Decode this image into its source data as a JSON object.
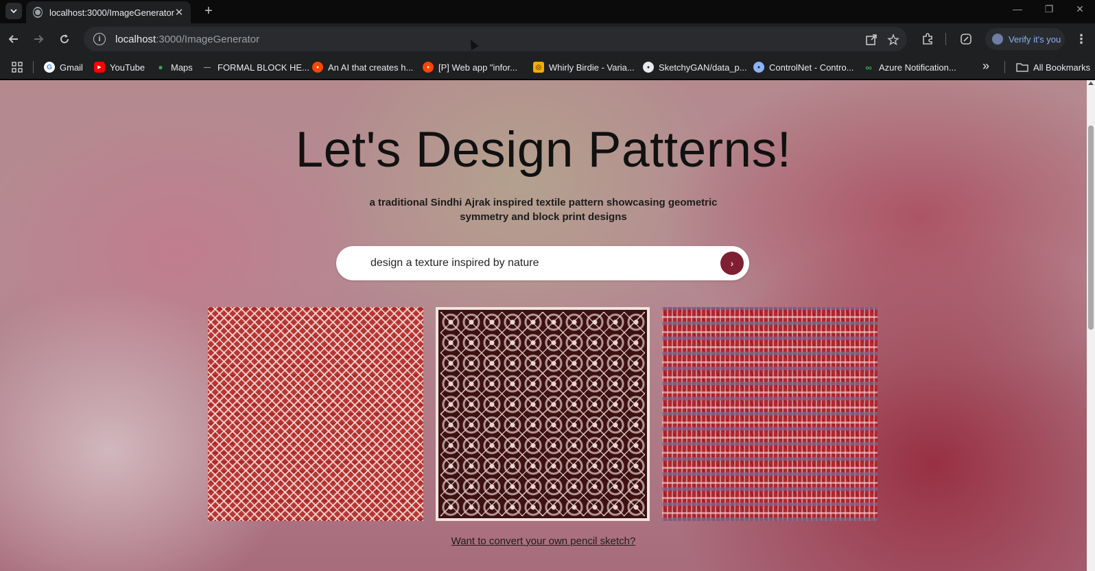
{
  "tab": {
    "title": "localhost:3000/ImageGenerator",
    "close": "✕",
    "new": "+"
  },
  "window": {
    "minimize": "—",
    "restore": "❐",
    "close": "✕"
  },
  "toolbar": {
    "url_host": "localhost",
    "url_path": ":3000/ImageGenerator",
    "verify_label": "Verify it's you",
    "menu": "⋮"
  },
  "bookmarks": {
    "items": [
      {
        "label": "Gmail",
        "icon": "google-icon",
        "color": "#4285f4",
        "glyph": "G"
      },
      {
        "label": "YouTube",
        "icon": "youtube-icon",
        "color": "#ff0000",
        "glyph": "▶"
      },
      {
        "label": "Maps",
        "icon": "maps-pin-icon",
        "color": "#34a853",
        "glyph": "●"
      },
      {
        "label": "FORMAL BLOCK HE...",
        "icon": "dash-icon",
        "color": "#5f6368",
        "glyph": "—"
      },
      {
        "label": "An AI that creates h...",
        "icon": "reddit-icon",
        "color": "#ff4500",
        "glyph": "●"
      },
      {
        "label": "[P] Web app \"infor...",
        "icon": "reddit-icon",
        "color": "#ff4500",
        "glyph": "●"
      },
      {
        "label": "Whirly Birdie - Varia...",
        "icon": "circle-square-icon",
        "color": "#f9ab00",
        "glyph": "◎"
      },
      {
        "label": "SketchyGAN/data_p...",
        "icon": "github-icon",
        "color": "#e8eaed",
        "glyph": "●"
      },
      {
        "label": "ControlNet - Contro...",
        "icon": "globe-icon",
        "color": "#8ab4f8",
        "glyph": "●"
      },
      {
        "label": "Azure Notification...",
        "icon": "azure-icon",
        "color": "#34a853",
        "glyph": "∞"
      }
    ],
    "overflow": "»",
    "all_bookmarks": "All Bookmarks"
  },
  "page": {
    "title": "Let's Design Patterns!",
    "subtitle": "a traditional Sindhi Ajrak inspired textile pattern showcasing geometric symmetry and block print designs",
    "prompt_value": "design a texture inspired by nature",
    "submit_glyph": "›",
    "sketch_link": "Want to convert your own pencil sketch?",
    "accent_color": "#7f1f34"
  }
}
